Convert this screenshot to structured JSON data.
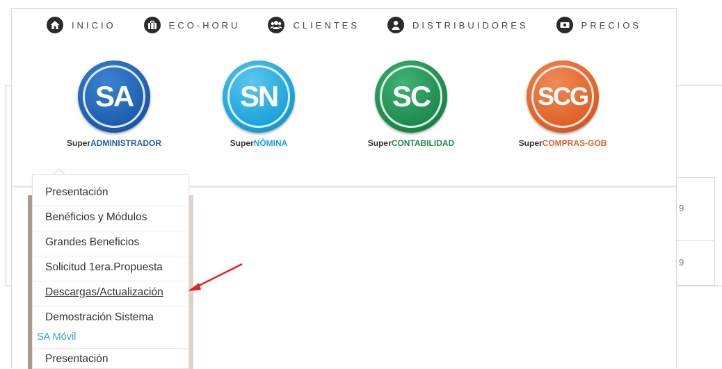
{
  "nav": {
    "items": [
      {
        "label": "INICIO",
        "icon": "home-icon"
      },
      {
        "label": "ECO-HORU",
        "icon": "briefcase-icon"
      },
      {
        "label": "CLIENTES",
        "icon": "users-icon"
      },
      {
        "label": "DISTRIBUIDORES",
        "icon": "user-icon"
      },
      {
        "label": "PRECIOS",
        "icon": "money-icon"
      }
    ]
  },
  "products": [
    {
      "abbr": "SA",
      "name_prefix": "Super",
      "name_main": "ADMINISTRADOR",
      "color": "#1d5fae",
      "name_color": "#1d5fae"
    },
    {
      "abbr": "SN",
      "name_prefix": "Super",
      "name_main": "NÓMINA",
      "color": "#1aa3da",
      "name_color": "#1aa3da"
    },
    {
      "abbr": "SC",
      "name_prefix": "Super",
      "name_main": "CONTABILIDAD",
      "color": "#1f8a4d",
      "name_color": "#1f8a4d"
    },
    {
      "abbr": "SCG",
      "name_prefix": "Super",
      "name_main": "COMPRAS-GOB",
      "color": "#e0622a",
      "name_color": "#e0622a"
    }
  ],
  "dropdown": {
    "items": [
      "Presentación",
      "Benéficios y Módulos",
      "Grandes Beneficios",
      "Solicitud 1era.Propuesta",
      "Descargas/Actualización",
      "Demostración Sistema"
    ],
    "section_heading": "SA Móvil",
    "section_items": [
      "Presentación"
    ]
  },
  "background": {
    "cells": [
      "9",
      "9"
    ]
  },
  "colors": {
    "annotation_arrow": "#e32222",
    "link_heading": "#3a9fd2"
  }
}
